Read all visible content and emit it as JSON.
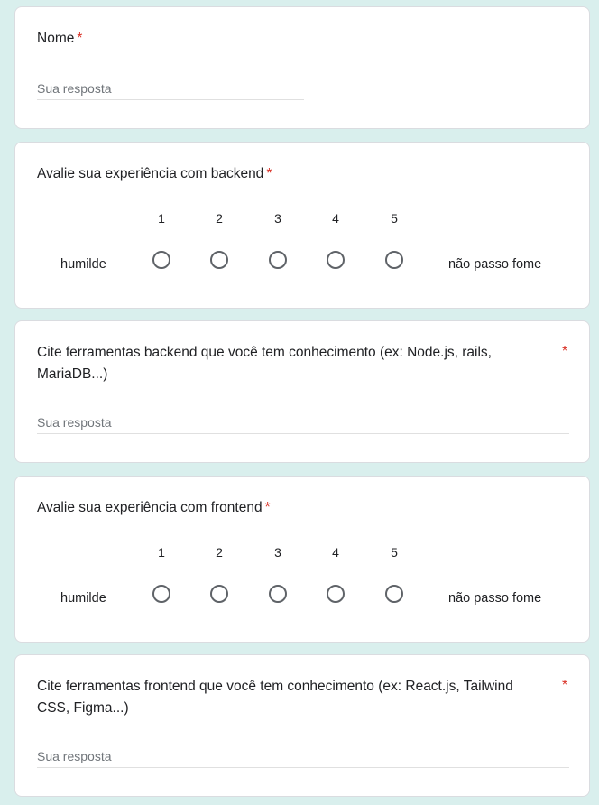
{
  "questions": {
    "nome": {
      "title": "Nome",
      "required": "*",
      "placeholder": "Sua resposta"
    },
    "backend_scale": {
      "title": "Avalie sua experiência com backend",
      "required": "*",
      "scale": [
        "1",
        "2",
        "3",
        "4",
        "5"
      ],
      "low_label": "humilde",
      "high_label": "não passo fome"
    },
    "backend_tools": {
      "title_line1": "Cite ferramentas backend que você tem conhecimento (ex: Node.js, rails,",
      "title_line2": "MariaDB...)",
      "required": "*",
      "placeholder": "Sua resposta"
    },
    "frontend_scale": {
      "title": "Avalie sua experiência com frontend",
      "required": "*",
      "scale": [
        "1",
        "2",
        "3",
        "4",
        "5"
      ],
      "low_label": "humilde",
      "high_label": "não passo fome"
    },
    "frontend_tools": {
      "title_line1": "Cite ferramentas frontend que você tem conhecimento (ex: React.js, Tailwind",
      "title_line2": "CSS, Figma...)",
      "required": "*",
      "placeholder": "Sua resposta"
    }
  },
  "colors": {
    "background": "#d9efed",
    "required": "#d93025",
    "radio_border": "#5f6368"
  }
}
